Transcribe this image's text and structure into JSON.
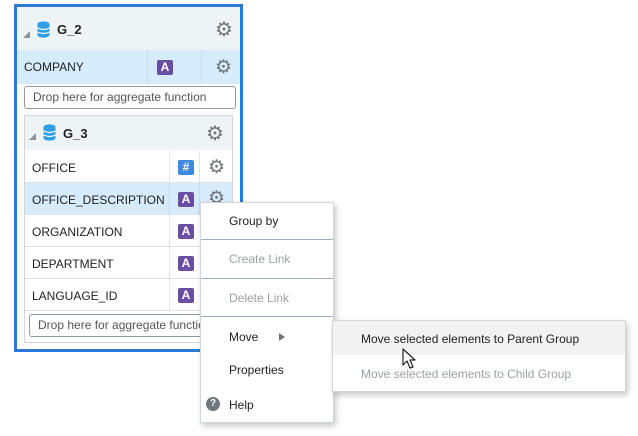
{
  "group_outer": {
    "name": "G_2",
    "element": {
      "label": "COMPANY",
      "type_badge": "A"
    },
    "drop_placeholder": "Drop here for aggregate function"
  },
  "group_inner": {
    "name": "G_3",
    "rows": [
      {
        "label": "OFFICE",
        "type_badge": "#"
      },
      {
        "label": "OFFICE_DESCRIPTION",
        "type_badge": "A"
      },
      {
        "label": "ORGANIZATION",
        "type_badge": "A"
      },
      {
        "label": "DEPARTMENT",
        "type_badge": "A"
      },
      {
        "label": "LANGUAGE_ID",
        "type_badge": "A"
      }
    ],
    "drop_placeholder": "Drop here for aggregate function"
  },
  "context_menu": {
    "items": [
      {
        "label": "Group by",
        "enabled": true
      },
      {
        "label": "Create Link",
        "enabled": false
      },
      {
        "label": "Delete Link",
        "enabled": false
      },
      {
        "label": "Move",
        "enabled": true,
        "has_submenu": true
      },
      {
        "label": "Properties",
        "enabled": true
      },
      {
        "label": "Help",
        "enabled": true,
        "icon": "help-icon"
      }
    ],
    "submenu": [
      {
        "label": "Move selected elements to Parent Group",
        "enabled": true,
        "highlighted": true
      },
      {
        "label": "Move selected elements to Child Group",
        "enabled": false
      }
    ]
  },
  "colors": {
    "group_border": "#2a79d6",
    "selected_row": "#d6ebfb",
    "badge_attribute": "#6a4ea3",
    "badge_number": "#3d8be0"
  }
}
